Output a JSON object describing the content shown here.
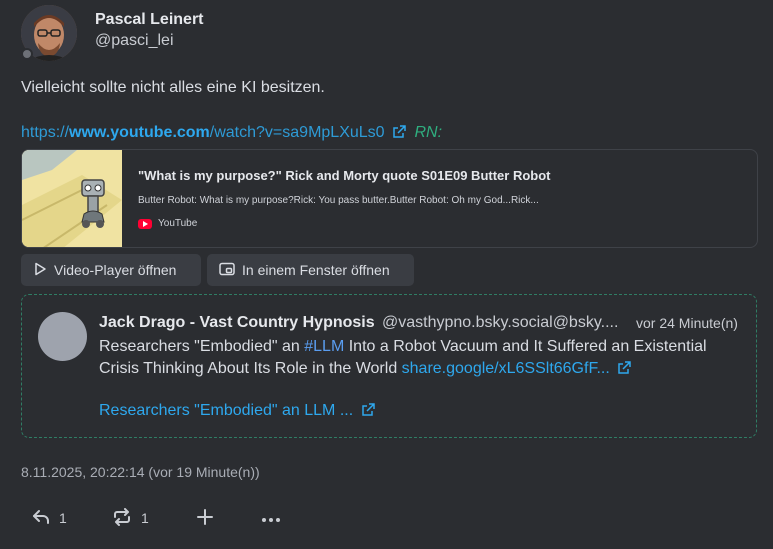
{
  "author": {
    "name": "Pascal Leinert",
    "handle": "@pasci_lei"
  },
  "note": {
    "text": "Vielleicht sollte nicht alles eine KI besitzen.",
    "link": {
      "scheme": "https://",
      "host": "www.youtube.com",
      "path": "/watch?v=sa9MpLXuLs0",
      "rn": "RN:"
    }
  },
  "preview": {
    "title": "\"What is my purpose?\" Rick and Morty quote S01E09 Butter Robot",
    "description": "Butter Robot: What is my purpose?Rick: You pass butter.Butter Robot: Oh my God...Rick...",
    "site": "YouTube"
  },
  "buttons": {
    "video_player": "Video-Player öffnen",
    "open_window": "In einem Fenster öffnen"
  },
  "quote": {
    "name": "Jack Drago - Vast Country Hypnosis",
    "handle": "@vasthypno.bsky.social@bsky....",
    "time": "vor 24 Minute(n)",
    "text_before": "Researchers \"Embodied\" an ",
    "hashtag": "#LLM",
    "text_after": " Into a Robot Vacuum and It Suffered an Existential Crisis Thinking About Its Role in the World ",
    "inline_link": "share.google/xL6SSlt66GfF...",
    "link_title": "Researchers \"Embodied\" an LLM ..."
  },
  "footer": {
    "timestamp": "8.11.2025, 20:22:14 (vor 19 Minute(n))",
    "reply_count": "1",
    "renote_count": "1"
  },
  "colors": {
    "background": "#2b2d31",
    "link": "#2ea8ee",
    "renote_accent": "#2fae7f",
    "quote_border": "#2f7d64",
    "youtube_red": "#ff0033"
  }
}
